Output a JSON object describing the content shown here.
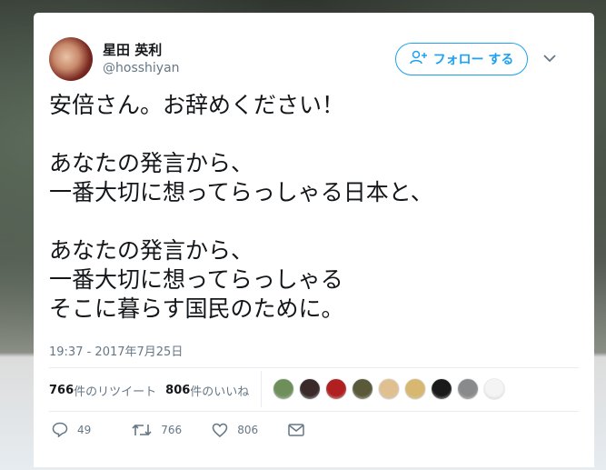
{
  "user": {
    "name": "星田 英利",
    "handle": "@hosshiyan"
  },
  "follow_button": {
    "label": "フォロー する"
  },
  "tweet": {
    "text": "安倍さん。お辞めください！\n\nあなたの発言から、\n一番大切に想ってらっしゃる日本と、\n\nあなたの発言から、\n一番大切に想ってらっしゃる\nそこに暮らす国民のために。",
    "timestamp": "19:37 - 2017年7月25日"
  },
  "stats": {
    "retweets_count": "766",
    "retweets_label": "件のリツイート",
    "likes_count": "806",
    "likes_label": "件のいいね"
  },
  "likers": [
    {
      "icon": "avatar-field",
      "color": "#6f8f5a"
    },
    {
      "icon": "avatar-dark",
      "color": "#3a2a2a"
    },
    {
      "icon": "avatar-red",
      "color": "#b02020"
    },
    {
      "icon": "avatar-olive",
      "color": "#5a5a3a"
    },
    {
      "icon": "avatar-cartoon",
      "color": "#e0c090"
    },
    {
      "icon": "avatar-tan",
      "color": "#d8b870"
    },
    {
      "icon": "avatar-beer",
      "color": "#1a1a1a"
    },
    {
      "icon": "avatar-sketch",
      "color": "#8a8a8a"
    },
    {
      "icon": "avatar-logo",
      "color": "#f4f4f4"
    }
  ],
  "actions": {
    "reply_count": "49",
    "retweet_count": "766",
    "like_count": "806"
  },
  "colors": {
    "accent": "#1da1f2",
    "text": "#14171a",
    "muted": "#657786",
    "border": "#e6ecf0"
  }
}
